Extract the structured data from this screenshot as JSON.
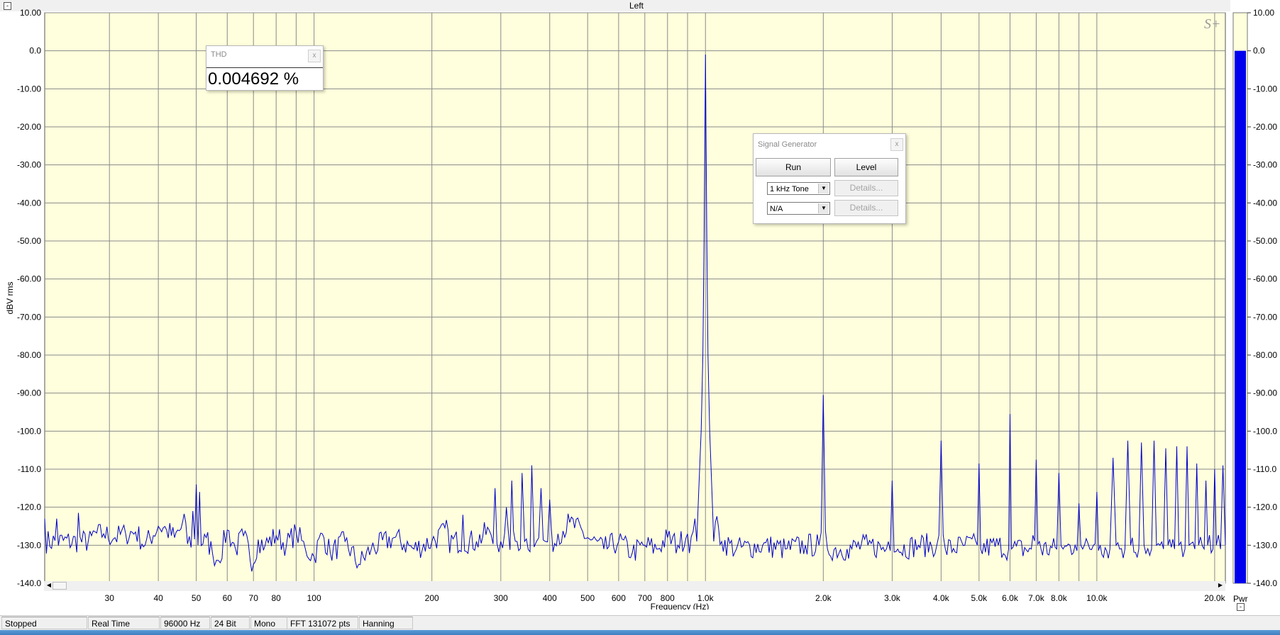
{
  "window": {
    "title": "Left",
    "collapse_glyph": "-"
  },
  "colors": {
    "plot_bg": "#ffffdd",
    "grid": "#8a8a8a",
    "trace": "#0000c8",
    "meter_bar": "#0000ee"
  },
  "logo": "S+",
  "thd": {
    "title": "THD",
    "value": "0.004692 %",
    "close": "x"
  },
  "signal_generator": {
    "title": "Signal Generator",
    "close": "x",
    "run_label": "Run",
    "level_label": "Level",
    "source1_selected": "1 kHz Tone",
    "source2_selected": "N/A",
    "details1_label": "Details...",
    "details2_label": "Details..."
  },
  "meter": {
    "label": "Pwr",
    "level_db": 0.0,
    "collapse_glyph": "-"
  },
  "scrollbar": {
    "left": "◀",
    "right": "▶"
  },
  "status": [
    "Stopped",
    "Real Time",
    "96000 Hz",
    "24 Bit",
    "Mono",
    "FFT 131072 pts",
    "Hanning"
  ],
  "chart_data": {
    "type": "line",
    "title": "Left",
    "xlabel": "Frequency (Hz)",
    "ylabel": "dBV rms",
    "x_scale": "log",
    "xlim": [
      20.5,
      21300
    ],
    "ylim": [
      -140,
      10
    ],
    "grid": true,
    "y_ticks": [
      "10.00",
      "0.0",
      "-10.00",
      "-20.00",
      "-30.00",
      "-40.00",
      "-50.00",
      "-60.00",
      "-70.00",
      "-80.00",
      "-90.00",
      "-100.0",
      "-110.0",
      "-120.0",
      "-130.0",
      "-140.0"
    ],
    "x_ticks": [
      {
        "v": 30,
        "label": "30"
      },
      {
        "v": 40,
        "label": "40"
      },
      {
        "v": 50,
        "label": "50"
      },
      {
        "v": 60,
        "label": "60"
      },
      {
        "v": 70,
        "label": "70"
      },
      {
        "v": 80,
        "label": "80"
      },
      {
        "v": 90,
        "label": ""
      },
      {
        "v": 100,
        "label": "100"
      },
      {
        "v": 200,
        "label": "200"
      },
      {
        "v": 300,
        "label": "300"
      },
      {
        "v": 400,
        "label": "400"
      },
      {
        "v": 500,
        "label": "500"
      },
      {
        "v": 600,
        "label": "600"
      },
      {
        "v": 700,
        "label": "700"
      },
      {
        "v": 800,
        "label": "800"
      },
      {
        "v": 900,
        "label": ""
      },
      {
        "v": 1000,
        "label": "1.0k"
      },
      {
        "v": 2000,
        "label": "2.0k"
      },
      {
        "v": 3000,
        "label": "3.0k"
      },
      {
        "v": 4000,
        "label": "4.0k"
      },
      {
        "v": 5000,
        "label": "5.0k"
      },
      {
        "v": 6000,
        "label": "6.0k"
      },
      {
        "v": 7000,
        "label": "7.0k"
      },
      {
        "v": 8000,
        "label": "8.0k"
      },
      {
        "v": 9000,
        "label": ""
      },
      {
        "v": 10000,
        "label": "10.0k"
      },
      {
        "v": 20000,
        "label": "20.0k"
      }
    ],
    "noise_floor_db": -130,
    "series": [
      {
        "points": [
          [
            20.5,
            -123
          ],
          [
            22,
            -123
          ],
          [
            25,
            -121.5
          ],
          [
            27,
            -127.5
          ],
          [
            29,
            -127
          ],
          [
            31,
            -128
          ],
          [
            33,
            -127
          ],
          [
            35,
            -126.5
          ],
          [
            37,
            -130
          ],
          [
            40,
            -125
          ],
          [
            42,
            -126
          ],
          [
            44,
            -128
          ],
          [
            47,
            -124
          ],
          [
            49,
            -121
          ],
          [
            50,
            -114
          ],
          [
            51,
            -116
          ],
          [
            53,
            -128
          ],
          [
            55,
            -132
          ],
          [
            57,
            -134
          ],
          [
            60,
            -126
          ],
          [
            63,
            -131
          ],
          [
            66,
            -127.5
          ],
          [
            70,
            -135
          ],
          [
            72,
            -128.5
          ],
          [
            75,
            -130
          ],
          [
            80,
            -127.5
          ],
          [
            85,
            -130
          ],
          [
            90,
            -126.5
          ],
          [
            95,
            -131
          ],
          [
            100,
            -133
          ],
          [
            105,
            -127
          ],
          [
            110,
            -132
          ],
          [
            120,
            -129
          ],
          [
            130,
            -135
          ],
          [
            140,
            -131
          ],
          [
            160,
            -128
          ],
          [
            180,
            -131
          ],
          [
            200,
            -129
          ],
          [
            220,
            -126
          ],
          [
            240,
            -122
          ],
          [
            260,
            -129
          ],
          [
            280,
            -126
          ],
          [
            290,
            -115
          ],
          [
            300,
            -129
          ],
          [
            310,
            -120
          ],
          [
            320,
            -113
          ],
          [
            330,
            -129
          ],
          [
            340,
            -111
          ],
          [
            345,
            -129
          ],
          [
            360,
            -109
          ],
          [
            370,
            -129
          ],
          [
            380,
            -115
          ],
          [
            390,
            -129
          ],
          [
            400,
            -118
          ],
          [
            420,
            -127
          ],
          [
            450,
            -124
          ],
          [
            500,
            -128
          ],
          [
            550,
            -131
          ],
          [
            600,
            -129
          ],
          [
            650,
            -132
          ],
          [
            700,
            -130
          ],
          [
            750,
            -131
          ],
          [
            800,
            -128
          ],
          [
            850,
            -130
          ],
          [
            900,
            -127
          ],
          [
            940,
            -123
          ],
          [
            960,
            -117
          ],
          [
            975,
            -100
          ],
          [
            985,
            -80
          ],
          [
            992,
            -50
          ],
          [
            997,
            -20
          ],
          [
            1000,
            -1
          ],
          [
            1003,
            -20
          ],
          [
            1008,
            -50
          ],
          [
            1015,
            -80
          ],
          [
            1025,
            -100
          ],
          [
            1040,
            -117
          ],
          [
            1060,
            -124
          ],
          [
            1100,
            -129
          ],
          [
            1200,
            -131
          ],
          [
            1400,
            -130
          ],
          [
            1600,
            -131
          ],
          [
            1800,
            -130
          ],
          [
            1950,
            -130
          ],
          [
            2000,
            -90.5
          ],
          [
            2050,
            -131
          ],
          [
            2300,
            -131
          ],
          [
            2600,
            -130
          ],
          [
            2900,
            -131
          ],
          [
            3000,
            -113
          ],
          [
            3100,
            -131
          ],
          [
            3500,
            -130
          ],
          [
            3900,
            -130
          ],
          [
            4000,
            -102.5
          ],
          [
            4100,
            -131
          ],
          [
            4600,
            -130
          ],
          [
            4950,
            -130
          ],
          [
            5000,
            -108.5
          ],
          [
            5050,
            -131
          ],
          [
            5600,
            -130
          ],
          [
            5950,
            -131
          ],
          [
            6000,
            -95.5
          ],
          [
            6050,
            -131
          ],
          [
            6800,
            -131
          ],
          [
            7000,
            -107.5
          ],
          [
            7200,
            -131
          ],
          [
            7900,
            -131
          ],
          [
            8000,
            -111
          ],
          [
            8200,
            -131
          ],
          [
            8800,
            -130
          ],
          [
            9000,
            -119
          ],
          [
            9200,
            -131
          ],
          [
            9800,
            -130
          ],
          [
            10000,
            -116
          ],
          [
            10200,
            -130
          ],
          [
            10800,
            -131
          ],
          [
            11000,
            -107
          ],
          [
            11200,
            -130
          ],
          [
            11800,
            -131
          ],
          [
            12000,
            -102.5
          ],
          [
            12200,
            -130
          ],
          [
            12800,
            -131
          ],
          [
            13000,
            -103
          ],
          [
            13200,
            -130
          ],
          [
            13800,
            -131
          ],
          [
            14000,
            -102.5
          ],
          [
            14200,
            -130
          ],
          [
            14800,
            -131
          ],
          [
            15000,
            -104.5
          ],
          [
            15200,
            -130
          ],
          [
            15800,
            -131
          ],
          [
            16000,
            -104
          ],
          [
            16200,
            -130
          ],
          [
            16800,
            -131
          ],
          [
            17000,
            -104
          ],
          [
            17200,
            -130
          ],
          [
            17800,
            -131
          ],
          [
            18000,
            -108.5
          ],
          [
            18200,
            -130
          ],
          [
            18800,
            -131
          ],
          [
            19000,
            -113
          ],
          [
            19200,
            -130
          ],
          [
            19800,
            -131
          ],
          [
            20000,
            -110
          ],
          [
            20200,
            -130
          ],
          [
            20700,
            -131
          ],
          [
            21000,
            -109
          ],
          [
            21300,
            -130
          ]
        ]
      }
    ]
  }
}
